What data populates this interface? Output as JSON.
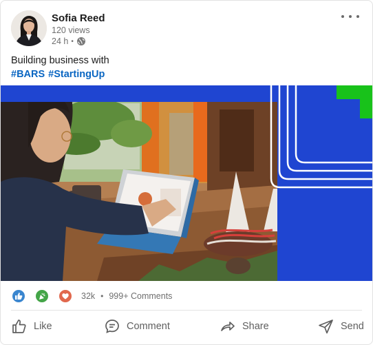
{
  "author": {
    "name": "Sofia Reed",
    "views": "120 views",
    "time": "24 h",
    "separator": "•"
  },
  "post": {
    "text": "Building business with",
    "hashtags": [
      "#BARS",
      "#StartingUp"
    ]
  },
  "image": {
    "subject": "woman-using-tablet-at-wooden-table",
    "brand_panel_color": "#1f45d1",
    "accent_color": "#18c21a"
  },
  "reactions": {
    "icons": [
      "like-icon",
      "celebrate-icon",
      "love-icon"
    ],
    "count": "32k",
    "separator": "•",
    "comments": "999+ Comments"
  },
  "actions": {
    "like": "Like",
    "comment": "Comment",
    "share": "Share",
    "send": "Send"
  },
  "colors": {
    "link": "#0a66c2",
    "like": "#3a86cf",
    "celebrate": "#44a548",
    "love": "#e1684d"
  }
}
